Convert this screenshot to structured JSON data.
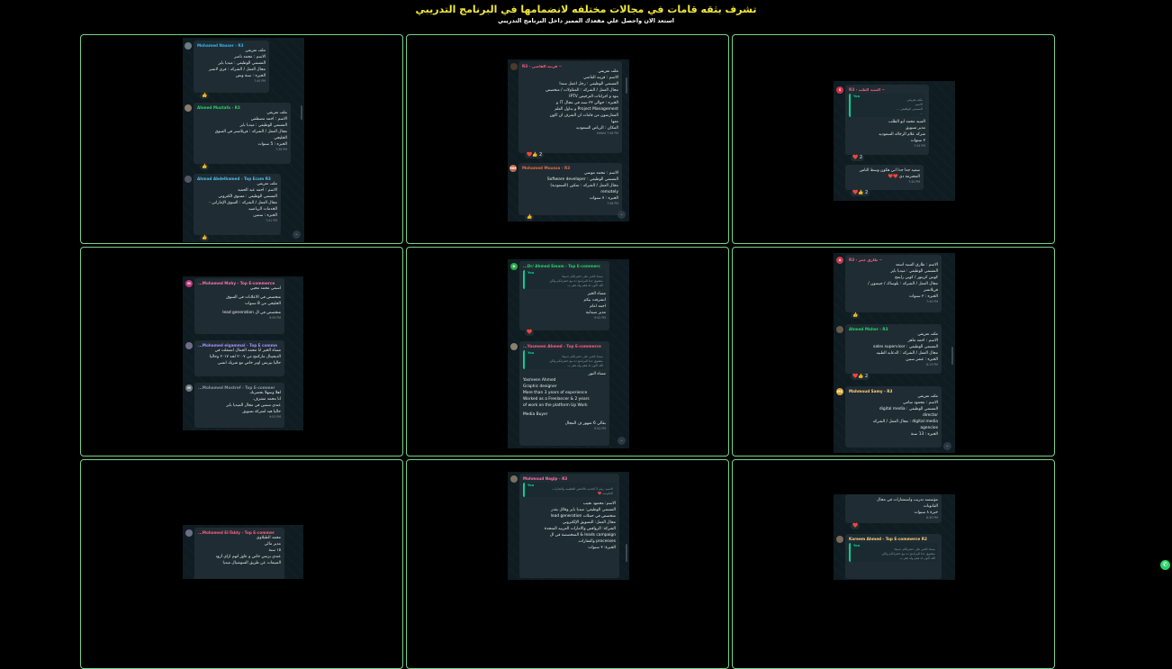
{
  "header": {
    "title": "تشرف بثقه قامات في مجالات مختلفه لانضمامها في البرنامج التدريبي",
    "subtitle": "استعد الان واحصل علي مقعدك المميز داخل البرنامج التدريبي"
  },
  "colors": {
    "accent_border": "#78d28a",
    "title": "#f2e93a",
    "chat_bg": "#0f1c21",
    "bubble": "#1f2c33",
    "whatsapp": "#25d366"
  },
  "cells": {
    "c1": {
      "m1": {
        "sender": "Mohamed Nasser - R3",
        "lines": [
          "ملف تعريفي",
          "الاسم : محمد ناصر",
          "المسمي الوظيفي : ميديا باير",
          "مجال العمل / الشركه : فري لانسر",
          "الخبره : سنة ونص"
        ],
        "time": "7:40 PM"
      },
      "m2": {
        "sender": "Ahmed Mustafa - R3",
        "lines": [
          "ملف تعريفي",
          "الاسم : احمد مصطفي",
          "المسمي الوظيفي : ميديا باير",
          "مجال العمل / الشركه : فريلانسر في السوق",
          "الخليجي",
          "الخبره : 5 سنوات"
        ],
        "time": "7:36 PM"
      },
      "m3": {
        "sender": "Ahmad Abdelhamed - Top Ecom R3",
        "lines": [
          "ملف تعريفي",
          "الاسم : احمد عبد الحميد",
          "المسمي الوظيفي : مسوق الكتروني",
          "مجال العمل / الشركه : السوق الإماراتي -",
          "الخدمات الرياضيه",
          "الخبره : سنتين"
        ],
        "time": "7:41 PM"
      }
    },
    "c2": {
      "m1": {
        "sender": "~ قرينه القاضي - R3",
        "lines": [
          "ملف تعريفي",
          "الاسم : قرينه القاضي",
          "المسمي الوظيفي : رجل اعمل مبتدا",
          "مجال العمل / الشركه : المقاولات / متخصص",
          "بنود و اجراءات الترخيص IPTV",
          "الخبره : حوالي ٣٣ سنه في مجال IT و",
          "Project Management و بداول العلم",
          "المعارضون من قامات ان الشرف ان اكون",
          "معها",
          "المكان : الرياض السعوديه"
        ],
        "time": "Edited 7:46 PM"
      },
      "m2": {
        "sender": "Mohamed Moussa - R3",
        "lines": [
          "الاسم : محمد موسي",
          "المسمي الوظيفي : Software developer",
          "مجال العمل / الشركه : تمكين (السعودية)",
          "remotely",
          "الخبره : ٧ سنوات"
        ],
        "time": "7:46 PM"
      }
    },
    "c3": {
      "m1": {
        "sender": "~ السيد الطب - R3",
        "quote_name": "You",
        "quote_lines": [
          "ملف تعريفي",
          "الاسم",
          "المسمي الوظيفي ...",
          "..."
        ],
        "lines": [
          "السيد محمد ابو الطلب",
          "مدير تسويق",
          "شركه علام الرخاله السعوديه",
          "٣ سنوات"
        ],
        "time": "7:44 PM"
      },
      "m2": {
        "lines": [
          "سعيد جدا جدا اني هكون وسط الناس",
          "المحترمة دي ❤️❤️"
        ],
        "time": "7:45 PM"
      }
    },
    "c4": {
      "m1": {
        "sender": "Mohamed Mohy - Top E-commerce...",
        "lines": [
          "اسمي محمد محيي",
          "متخصص في الاعلانات في السوق",
          "الخليجي من 8 سنوات",
          "متخصص في ال lead generation"
        ],
        "time": "9:59 PM"
      },
      "m2": {
        "sender": "Mohamed elgammal - Top E comme...",
        "lines": [
          "مساء الخير انا محمد الجمال اشتغلت في",
          "الديجيتال ماركتنج من ٢٠٠٧ لحد ٢٠١٧ وحاليا",
          "حاليا بيزنس اونر خاص مع شريك انسي"
        ],
        "time": ""
      },
      "m3": {
        "sender": "Mohamed Mostref - Top E-commer...",
        "lines": [
          "اهلا وسهلا بحضرتك",
          "انا محمد مشرف.",
          "عندي سنتين في مجال الميديا باير",
          "حاليا هيد لشركة تسويق"
        ],
        "time": "9:53 PM"
      }
    },
    "c5": {
      "m1": {
        "sender": "Dr/ Ahmed Emam - Top E-commerc...",
        "quote_name": "You",
        "quote_lines": [
          "مساء الخير على حضراتكم جميعا",
          "متشوق جدا للبرنامج ده مع حضراتكم ولكن",
          "الله اكون له فقم وله فقر ب"
        ],
        "lines": [
          "مساء الخير",
          "اتشرفت بيكم",
          "احمد امام",
          "مدير صيدلية"
        ],
        "time": "9:52 PM"
      },
      "m2": {
        "sender": "Yasmeen Ahmed - Top E-commerce...",
        "quote_name": "You",
        "quote_lines": [
          "مساء الخير على حضراتكم جميعا",
          "متشوق جدا للبرنامج ده مع حضراتكم ولكن",
          "الله اكون له فقم وله فقر ب"
        ],
        "lines": [
          "مساء النور"
        ],
        "lines_ltr": [
          "Yasmeen Ahmed",
          "Graphic designer",
          "More than 3 years of experience",
          "Worked as a Freelancer & 2 years",
          "of work on the platform Up Work",
          "",
          "Media Buyer"
        ],
        "lines2": [
          "بقالي 6 شهور ف المجال"
        ],
        "time": "9:54 PM"
      }
    },
    "c6": {
      "m1": {
        "sender": "~ طارق عمر - R3",
        "lines": [
          "الاسم : طارق السيد اسعد",
          "المسمي الوظيفي : ميديا باير",
          "كونتن كريتور / كوبي رايتنج",
          "مجال العمل / الشركه : بلوساك / جيسون /",
          "فريلانسر",
          "الخبره : ٣ سنوات"
        ],
        "time": "7:49 PM"
      },
      "m2": {
        "sender": "Ahmed Maher - R3",
        "lines": [
          "ملف تعريفي",
          "الاسم : احمد ماهر",
          "المسمي الوظيفي : sales supervisor",
          "مجال العمل / الشركه : الدعايه الطبيه",
          "الخبره : عشر سنين"
        ],
        "time": "8:13 PM"
      },
      "m3": {
        "sender": "Mahmoud Samy - R3",
        "lines": [
          "ملف تعريفي",
          "الاسم : محمود سامي",
          "المسمي الوظيفي : digital media",
          "director",
          "digital media : مجال العمل / الشركه",
          "agencies",
          "الخبره : 13 سنة"
        ],
        "time": ""
      }
    },
    "c7": {
      "m1": {
        "sender": "Mohamed El-Tably - Top E-commer...",
        "lines": [
          "محمد الطبلاوي",
          "مدير مالي",
          "١٥ سنة",
          "عندي بزنس خاص و عاوز اتهم ازاي أزود",
          "المبيعات عن طريق السوشيال ميديا"
        ],
        "time": ""
      }
    },
    "c8": {
      "m1": {
        "sender": "Mahmoud Nagip - R3",
        "quote_name": "You",
        "quote_lines": [
          "الاسم: رقم 3 الحديه ذاالحص العظيمه والتجارات",
          "الحلوسه ❤️"
        ],
        "lines": [
          "الاسم: محمود نجيب",
          "المسمي الوظيفي: ميديا باير وقائل بقدر",
          "متخصص في حملات lead generation",
          "مجال العمل: التسويق الإلكتروني",
          "الشركة: الرواقص والامارات العربيه المتحدة",
          "leads campaign & المتخصصة في ال",
          "processes والعقارات.",
          "الخبرة: ٣ سنوات"
        ],
        "time": "7:21 PM"
      }
    },
    "c9": {
      "m1": {
        "lines": [
          "مؤسسه تدريب واستشارات في مجال",
          "القانونات",
          "خبرة ٨ سنوات"
        ],
        "time": "6:30 PM"
      },
      "m2": {
        "sender": "Kareem Ahmed - Top E-commerce R2",
        "quote_name": "You",
        "quote_lines": [
          "مساء الخير على حضراتكم جميعا",
          "متشوق جدا للبرنامج ده مع حضراتكم ولكن",
          "الله اكون له فقم وله فقر ب"
        ],
        "lines": [],
        "time": ""
      }
    }
  }
}
